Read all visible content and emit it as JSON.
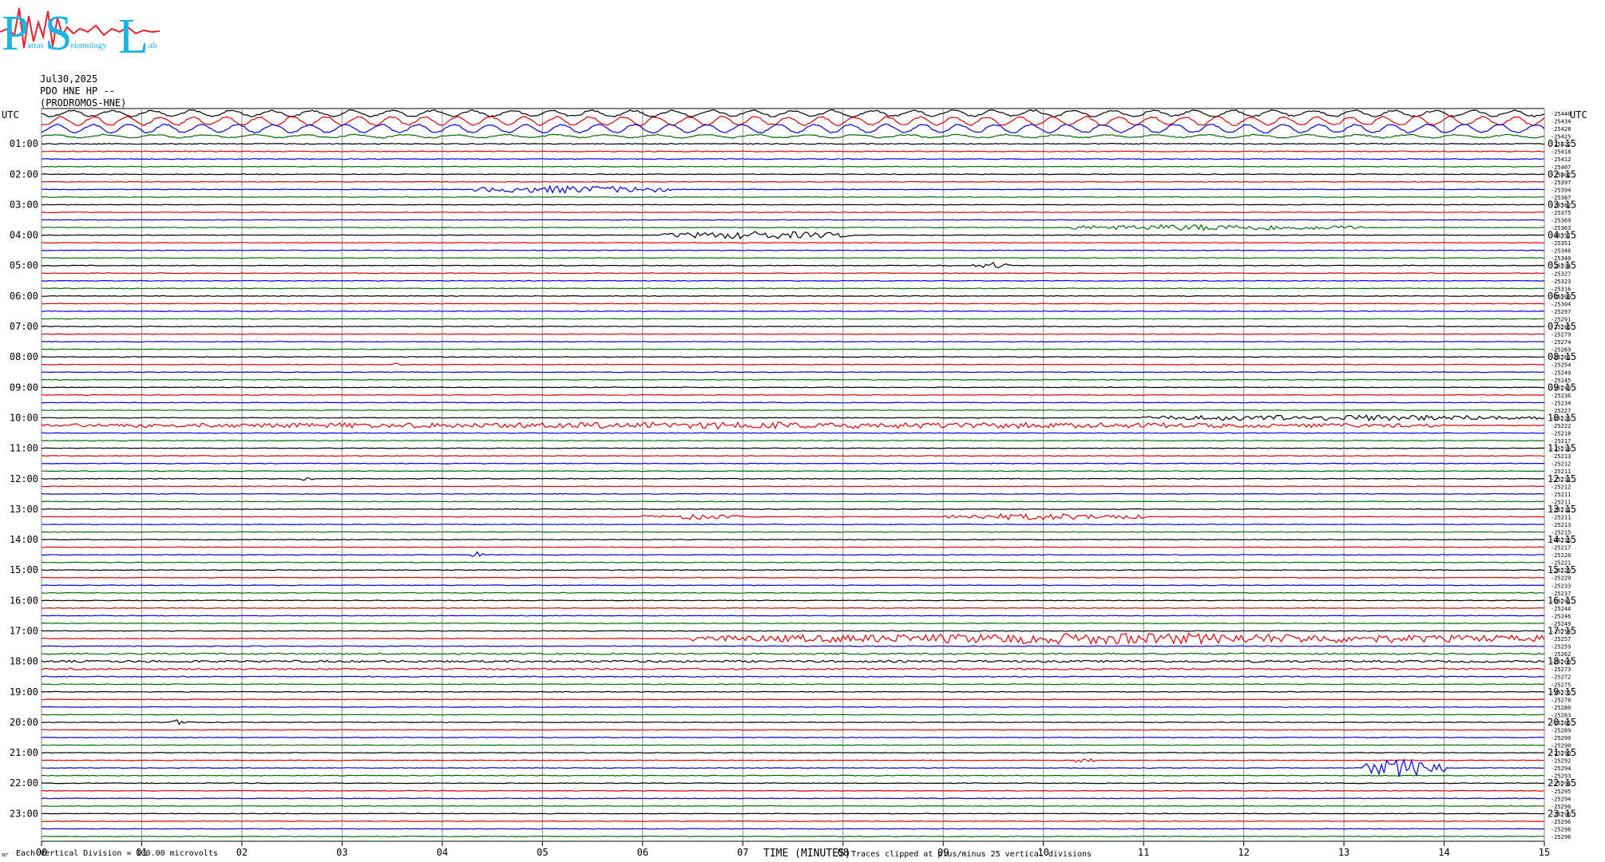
{
  "logo": {
    "big_letters": [
      "P",
      "S",
      "L"
    ],
    "small_words": [
      "atras",
      "eismology",
      "ab"
    ],
    "colors": {
      "letters": "#19b3e6",
      "wave": "#e8202a"
    }
  },
  "header": {
    "date": "Jul30,2025",
    "station": "PDO HNE HP --",
    "name": "(PRODROMOS-HNE)"
  },
  "footer": {
    "vertical_division": "Each Vertical Division =  100.00 microvolts",
    "xlabel": "TIME (MINUTES)",
    "clip_note": "Traces clipped at plus/minus 25 vertical divisions",
    "corner_mark": "ar"
  },
  "chart_data": {
    "type": "line",
    "title": "",
    "utc_label": "UTC",
    "xlabel": "TIME (MINUTES)",
    "xlim": [
      0,
      15
    ],
    "x_ticks": [
      "00",
      "01",
      "02",
      "03",
      "04",
      "05",
      "06",
      "07",
      "08",
      "09",
      "10",
      "11",
      "12",
      "13",
      "14",
      "15"
    ],
    "rows_per_hour": 4,
    "minutes_per_row": 15,
    "trace_colors": [
      "#000000",
      "#e00000",
      "#0000e0",
      "#007000"
    ],
    "left_hour_labels": [
      "01:00",
      "02:00",
      "03:00",
      "04:00",
      "05:00",
      "06:00",
      "07:00",
      "08:00",
      "09:00",
      "10:00",
      "11:00",
      "12:00",
      "13:00",
      "14:00",
      "15:00",
      "16:00",
      "17:00",
      "18:00",
      "19:00",
      "20:00",
      "21:00",
      "22:00",
      "23:00"
    ],
    "right_hour_labels": [
      "01:15",
      "02:15",
      "03:15",
      "04:15",
      "05:15",
      "06:15",
      "07:15",
      "08:15",
      "09:15",
      "10:15",
      "11:15",
      "12:15",
      "13:15",
      "14:15",
      "15:15",
      "16:15",
      "17:15",
      "18:15",
      "19:15",
      "20:15",
      "21:15",
      "22:15",
      "23:15"
    ],
    "row_offsets": [
      "-25440",
      "-25434",
      "-25428",
      "-25425",
      "-25422",
      "-25418",
      "-25412",
      "-25407",
      "-25402",
      "-25397",
      "-25394",
      "-25387",
      "-25382",
      "-25375",
      "-25369",
      "-25363",
      "-25357",
      "-25351",
      "-25346",
      "-25340",
      "-25334",
      "-25327",
      "-25323",
      "-25316",
      "-25309",
      "-25304",
      "-25297",
      "-25291",
      "-25285",
      "-25279",
      "-25274",
      "-25269",
      "-25261",
      "-25254",
      "-25249",
      "-25245",
      "-25240",
      "-25236",
      "-25234",
      "-25227",
      "-25225",
      "-25222",
      "-25218",
      "-25217",
      "-25216",
      "-25213",
      "-25212",
      "-25211",
      "-25211",
      "-25212",
      "-25211",
      "-25211",
      "-25211",
      "-25211",
      "-25213",
      "-25215",
      "-25216",
      "-25217",
      "-25220",
      "-25221",
      "-25225",
      "-25229",
      "-25233",
      "-25237",
      "-25241",
      "-25244",
      "-25246",
      "-25249",
      "-25254",
      "-25257",
      "-25259",
      "-25262",
      "-25268",
      "-25273",
      "-25272",
      "-25275",
      "-25275",
      "-25278",
      "-25280",
      "-25283",
      "-25285",
      "-25289",
      "-25290",
      "-25290",
      "-25290",
      "-25292",
      "-25294",
      "-25293",
      "-25294",
      "-25295",
      "-25294",
      "-25296",
      "-25296",
      "-25296",
      "-25296",
      "-25296"
    ],
    "noise_level": [
      2.2,
      2.0,
      1.6,
      1.4,
      1.2,
      1.0,
      1.0,
      0.9,
      0.8,
      0.8,
      0.8,
      0.8,
      0.8,
      0.8,
      0.8,
      0.8,
      0.8,
      0.8,
      0.8,
      0.8,
      0.8,
      0.8,
      0.8,
      0.8,
      0.8,
      0.8,
      0.8,
      0.8,
      0.8,
      0.8,
      0.8,
      0.8,
      0.8,
      0.8,
      0.8,
      0.8,
      0.8,
      0.8,
      0.8,
      0.8,
      0.8,
      0.9,
      0.8,
      0.8,
      0.8,
      0.8,
      0.8,
      0.8,
      0.8,
      0.8,
      0.8,
      0.8,
      0.8,
      0.8,
      0.8,
      0.8,
      0.8,
      0.8,
      0.8,
      0.9,
      0.8,
      0.8,
      0.8,
      0.8,
      0.8,
      0.8,
      0.8,
      0.8,
      0.8,
      0.8,
      0.9,
      1.8,
      2.6,
      2.0,
      1.2,
      0.9,
      0.8,
      0.8,
      0.8,
      0.8,
      0.8,
      0.8,
      0.8,
      0.8,
      0.8,
      0.8,
      0.8,
      0.8,
      0.8,
      0.8,
      0.8,
      0.8,
      0.8,
      0.8,
      0.8,
      0.8
    ],
    "long_period_waves": [
      {
        "row": 0,
        "amplitude": 3.5,
        "period_min": 0.4
      },
      {
        "row": 1,
        "amplitude": 5,
        "period_min": 0.33
      },
      {
        "row": 2,
        "amplitude": 5,
        "period_min": 0.36
      },
      {
        "row": 3,
        "amplitude": 1.8,
        "period_min": 0.5
      }
    ],
    "events": [
      {
        "row": 10,
        "start_min": 4.3,
        "end_min": 6.3,
        "amplitude": 5
      },
      {
        "row": 15,
        "start_min": 10.2,
        "end_min": 13.2,
        "amplitude": 4
      },
      {
        "row": 16,
        "start_min": 6.2,
        "end_min": 8.1,
        "amplitude": 5
      },
      {
        "row": 20,
        "start_min": 9.3,
        "end_min": 9.7,
        "amplitude": 4
      },
      {
        "row": 33,
        "start_min": 3.5,
        "end_min": 3.6,
        "amplitude": 3
      },
      {
        "row": 40,
        "start_min": 11.0,
        "end_min": 15.0,
        "amplitude": 4
      },
      {
        "row": 41,
        "start_min": 0.0,
        "end_min": 14.0,
        "amplitude": 4
      },
      {
        "row": 48,
        "start_min": 2.6,
        "end_min": 2.7,
        "amplitude": 5
      },
      {
        "row": 53,
        "start_min": 9.0,
        "end_min": 11.0,
        "amplitude": 4
      },
      {
        "row": 53,
        "start_min": 6.0,
        "end_min": 7.0,
        "amplitude": 3
      },
      {
        "row": 58,
        "start_min": 4.3,
        "end_min": 4.4,
        "amplitude": 4
      },
      {
        "row": 69,
        "start_min": 6.5,
        "end_min": 15.0,
        "amplitude": 7
      },
      {
        "row": 80,
        "start_min": 1.3,
        "end_min": 1.5,
        "amplitude": 4
      },
      {
        "row": 85,
        "start_min": 10.3,
        "end_min": 10.5,
        "amplitude": 3
      },
      {
        "row": 86,
        "start_min": 13.2,
        "end_min": 14.0,
        "amplitude": 12
      }
    ]
  }
}
